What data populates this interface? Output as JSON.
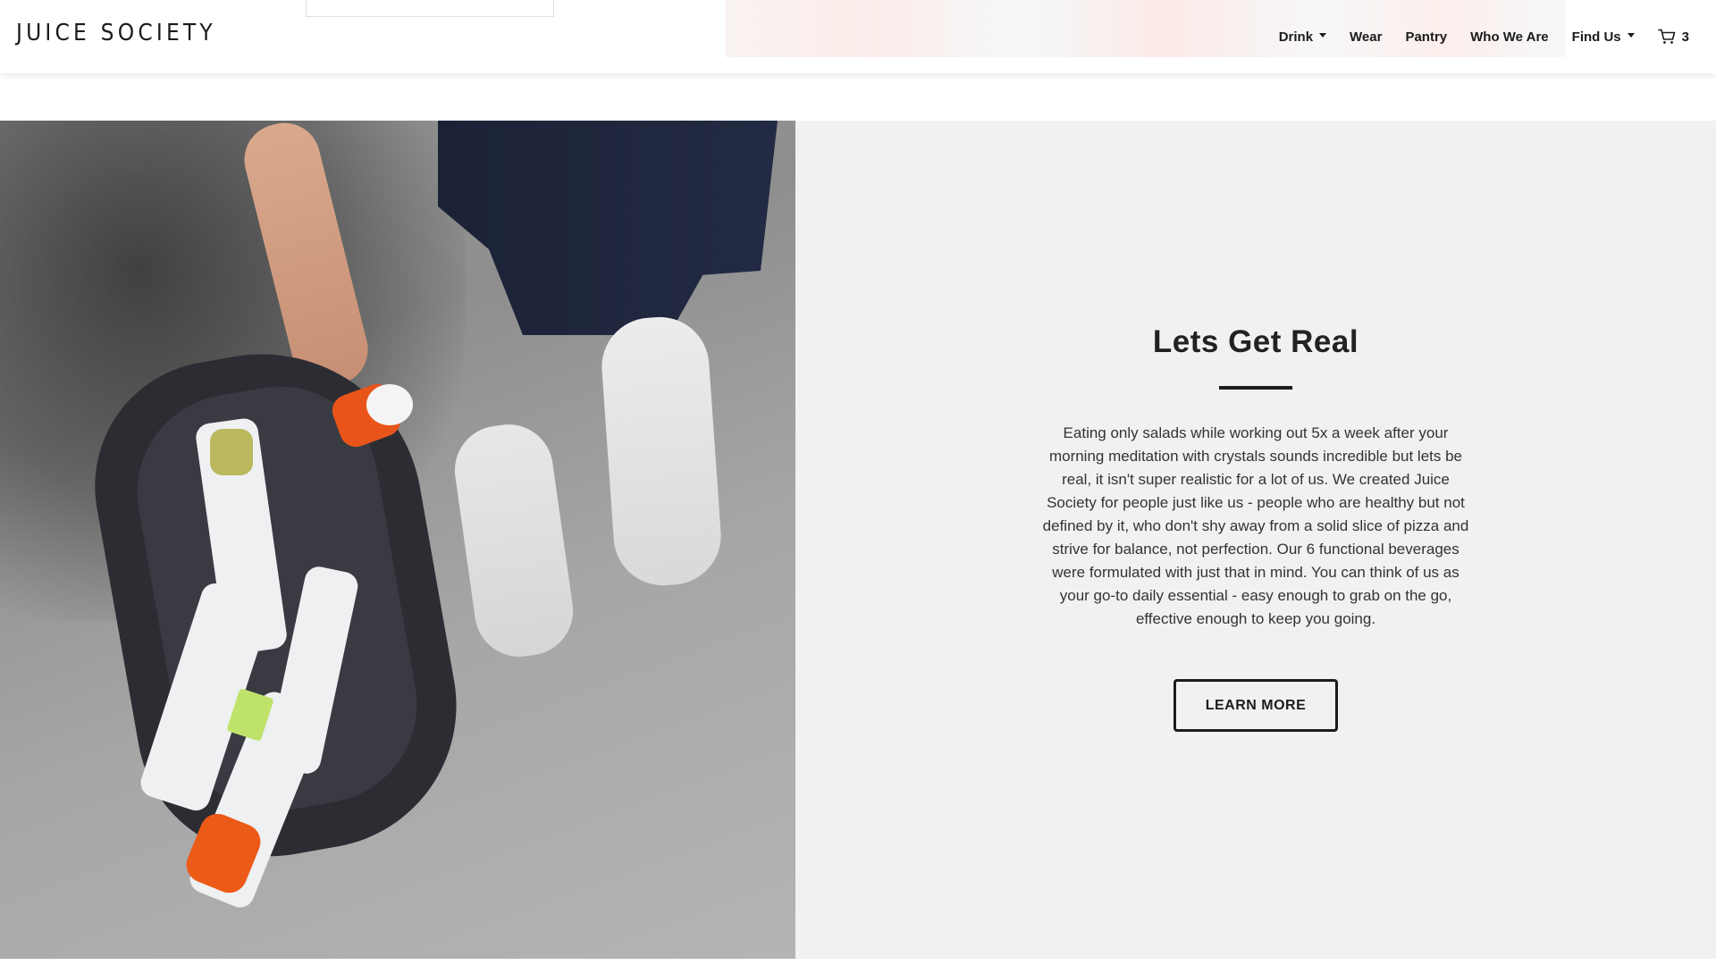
{
  "header": {
    "logo": "JUICE SOCIETY",
    "nav": [
      {
        "label": "Drink",
        "dropdown": true
      },
      {
        "label": "Wear",
        "dropdown": false
      },
      {
        "label": "Pantry",
        "dropdown": false
      },
      {
        "label": "Who We Are",
        "dropdown": false
      },
      {
        "label": "Find Us",
        "dropdown": true
      }
    ],
    "cart": {
      "icon": "cart-icon",
      "count": "3"
    }
  },
  "hero": {
    "title": "Lets Get Real",
    "body": "Eating only salads while working out 5x a week after your morning meditation with crystals sounds incredible but lets be real, it isn't super realistic for a lot of us. We created Juice Society for people just like us - people who are healthy but not defined by it, who don't shy away from a solid slice of pizza and strive for balance, not perfection. Our 6 functional beverages were formulated with just that in mind. You can think of us as your go-to daily essential - easy enough to grab on the go, effective enough to keep you going.",
    "button_label": "LEARN MORE"
  },
  "colors": {
    "panel_background": "#f1f1f1",
    "text": "#222222",
    "accent_rule": "#1c1c1c"
  }
}
